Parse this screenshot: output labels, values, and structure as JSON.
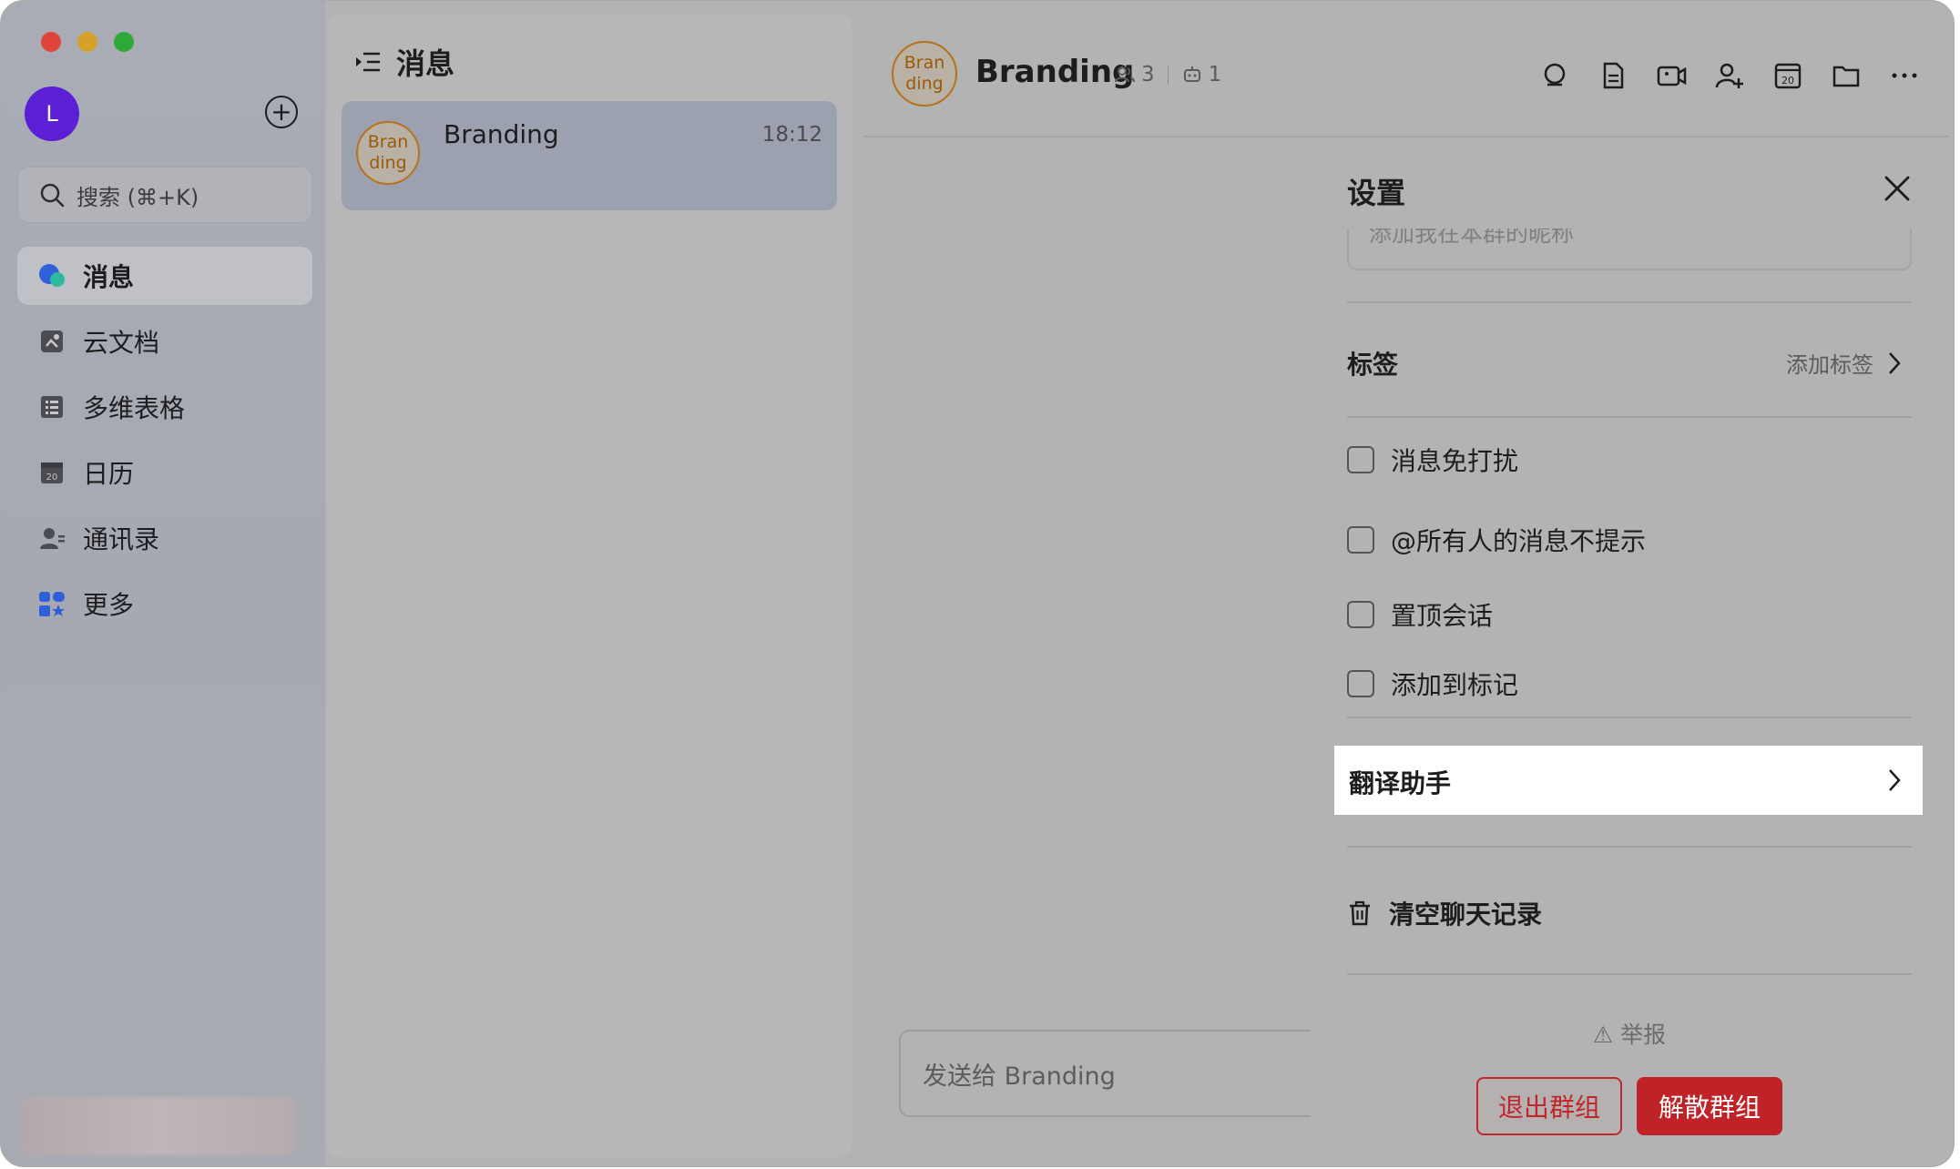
{
  "sidebar": {
    "user_initial": "L",
    "search_placeholder": "搜索 (⌘+K)",
    "items": [
      {
        "label": "消息",
        "icon": "chat-bubble-icon"
      },
      {
        "label": "云文档",
        "icon": "cloud-doc-icon"
      },
      {
        "label": "多维表格",
        "icon": "table-icon"
      },
      {
        "label": "日历",
        "icon": "calendar-icon"
      },
      {
        "label": "通讯录",
        "icon": "contacts-icon"
      },
      {
        "label": "更多",
        "icon": "apps-icon"
      }
    ]
  },
  "message_list": {
    "title": "消息",
    "conversations": [
      {
        "name": "Branding",
        "time": "18:12",
        "avatar_text": "Bran ding"
      }
    ]
  },
  "chat": {
    "title": "Branding",
    "avatar_text_line1": "Bran",
    "avatar_text_line2": "ding",
    "member_count": "3",
    "bot_count": "1",
    "input_placeholder": "发送给 Branding"
  },
  "settings": {
    "title": "设置",
    "nickname_placeholder": "添加我在本群的昵称",
    "tag_label": "标签",
    "tag_action": "添加标签",
    "options": [
      {
        "label": "消息免打扰",
        "checked": false
      },
      {
        "label": "@所有人的消息不提示",
        "checked": false
      },
      {
        "label": "置顶会话",
        "checked": false
      },
      {
        "label": "添加到标记",
        "checked": false
      }
    ],
    "translate_label": "翻译助手",
    "clear_label": "清空聊天记录",
    "report_label": "举报",
    "exit_label": "退出群组",
    "disband_label": "解散群组"
  },
  "colors": {
    "accent_red": "#bf2227",
    "avatar_purple": "#5b1fd6",
    "branding_orange": "#b5721c"
  }
}
